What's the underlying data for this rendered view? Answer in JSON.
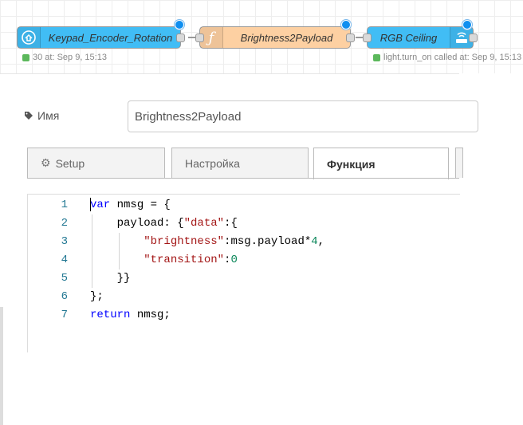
{
  "flow": {
    "nodes": [
      {
        "label": "Keypad_Encoder_Rotation",
        "icon": "home-assistant-icon",
        "color": "#41BDF5"
      },
      {
        "label": "Brightness2Payload",
        "icon": "function-icon",
        "color": "#FDD0A2"
      },
      {
        "label": "RGB Ceiling",
        "icon": "router-icon",
        "color": "#41BDF5"
      }
    ],
    "status": [
      {
        "text": "30 at: Sep 9, 15:13"
      },
      {
        "text": "light.turn_on called at: Sep 9, 15:13"
      }
    ]
  },
  "panel": {
    "name_label": "Имя",
    "name_value": "Brightness2Payload",
    "tabs": [
      {
        "label": "Setup",
        "icon": "gear-icon"
      },
      {
        "label": "Настройка"
      },
      {
        "label": "Функция"
      }
    ],
    "active_tab": "Функция"
  },
  "code": {
    "line_numbers": [
      "1",
      "2",
      "3",
      "4",
      "5",
      "6",
      "7"
    ],
    "lines": [
      "var nmsg = {",
      "    payload: {\"data\":{",
      "        \"brightness\":msg.payload*4,",
      "        \"transition\":0",
      "    }}",
      "};",
      "return nmsg;"
    ]
  },
  "colors": {
    "ha_node": "#41BDF5",
    "function_node": "#FDD0A2",
    "status_ok": "#5cb85c",
    "keyword": "#0000ff",
    "string": "#a31515",
    "number": "#098658",
    "line_number": "#237893"
  }
}
